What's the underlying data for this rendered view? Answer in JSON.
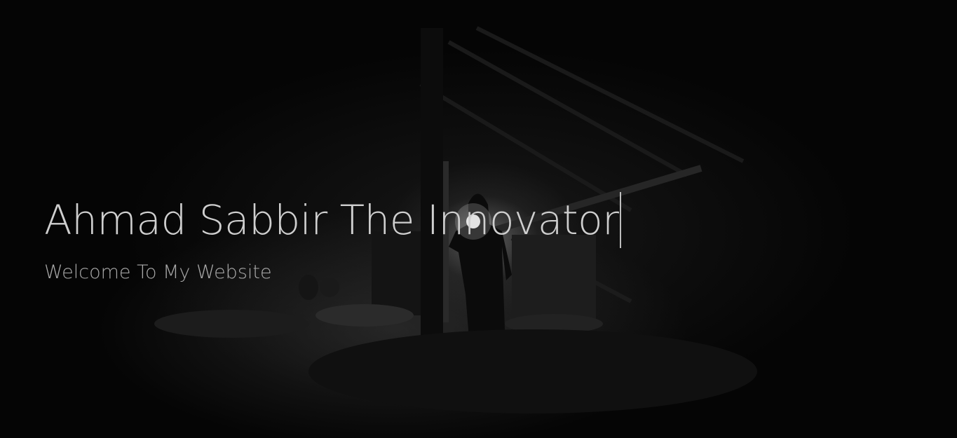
{
  "hero": {
    "title": "Ahmad Sabbir The Innovator",
    "subtitle": "Welcome To My Website"
  }
}
